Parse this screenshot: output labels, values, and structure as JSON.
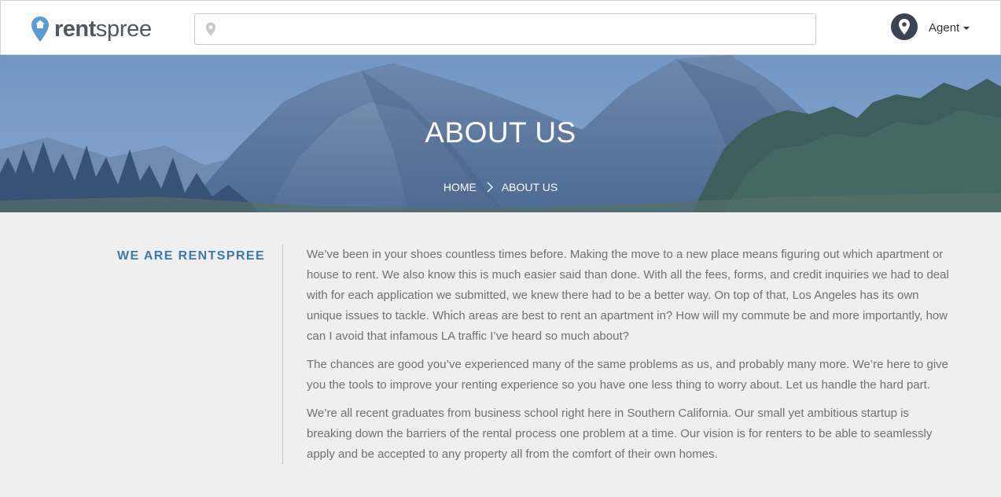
{
  "header": {
    "logo": {
      "part1": "rent",
      "part2": "spree"
    },
    "search": {
      "value": "",
      "placeholder": ""
    },
    "user_menu": {
      "label": "Agent"
    }
  },
  "hero": {
    "title": "ABOUT US",
    "breadcrumb": {
      "home": "HOME",
      "current": "ABOUT US"
    }
  },
  "content": {
    "section_title": "WE ARE RENTSPREE",
    "paragraphs": [
      "We’ve been in your shoes countless times before. Making the move to a new place means figuring out which apartment or house to rent. We also know this is much easier said than done. With all the fees, forms, and credit inquiries we had to deal with for each application we submitted, we knew there had to be a better way. On top of that, Los Angeles has its own unique issues to tackle. Which areas are best to rent an apartment in? How will my commute be and more importantly, how can I avoid that infamous LA traffic I’ve heard so much about?",
      "The chances are good you’ve experienced many of the same problems as us, and probably many more. We’re here to give you the tools to improve your renting experience so you have one less thing to worry about. Let us handle the hard part.",
      "We’re all recent graduates from business school right here in Southern California. Our small yet ambitious startup is breaking down the barriers of the rental process one problem at a time. Our vision is for renters to be able to seamlessly apply and be accepted to any property all from the comfort of their own homes."
    ]
  },
  "colors": {
    "brand_blue": "#3a79b0",
    "logo_pin": "#5b9bd5",
    "avatar_bg": "#3a4453",
    "text_gray": "#707070"
  },
  "icons": {
    "logo": "map-pin-house-icon",
    "search": "location-pin-icon",
    "avatar": "location-pin-icon",
    "user_menu": "caret-down-icon",
    "breadcrumb": "chevron-right-icon"
  }
}
